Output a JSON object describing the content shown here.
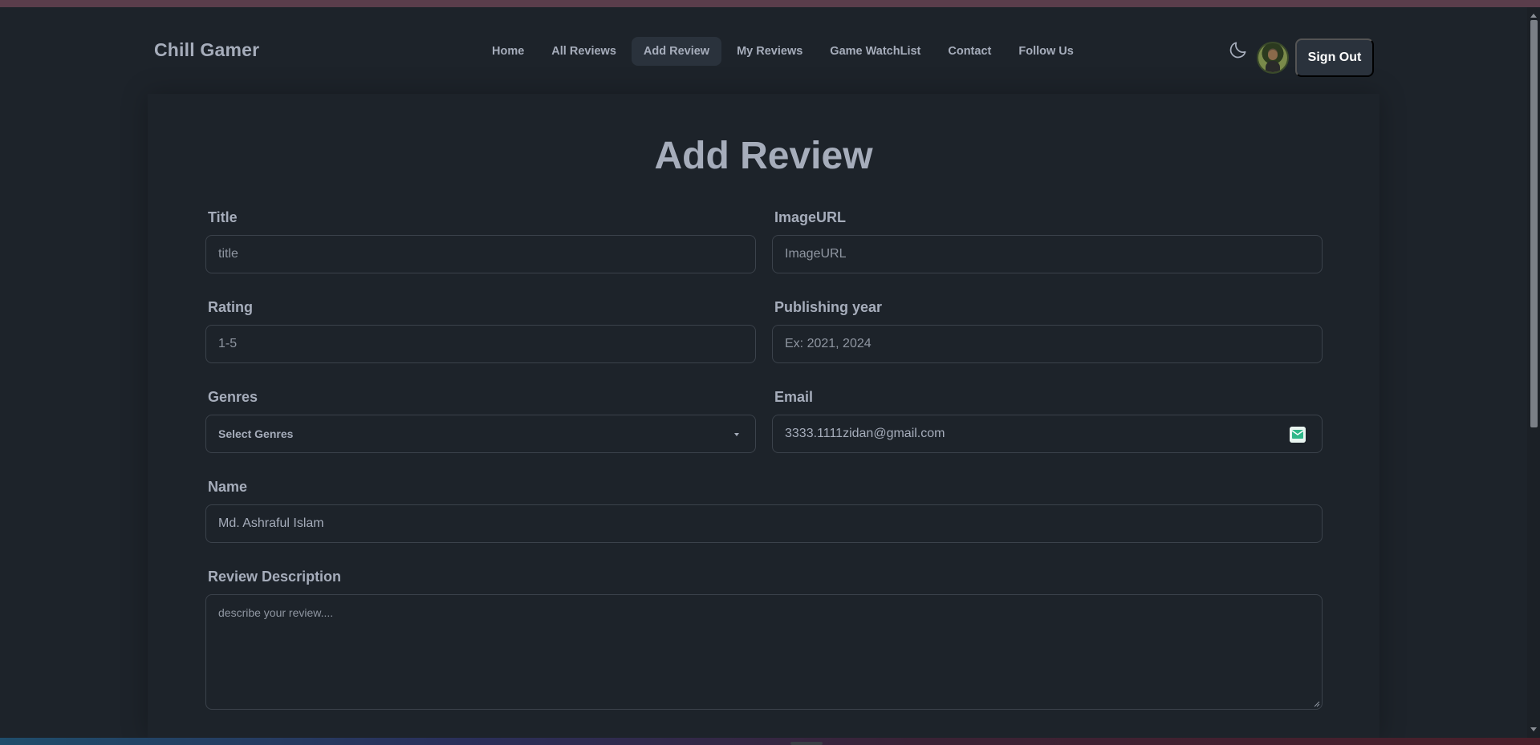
{
  "navbar": {
    "logo": "Chill Gamer",
    "menu": [
      {
        "label": "Home",
        "active": false
      },
      {
        "label": "All Reviews",
        "active": false
      },
      {
        "label": "Add Review",
        "active": true
      },
      {
        "label": "My Reviews",
        "active": false
      },
      {
        "label": "Game WatchList",
        "active": false
      },
      {
        "label": "Contact",
        "active": false
      },
      {
        "label": "Follow Us",
        "active": false
      }
    ],
    "theme_icon": "moon-icon",
    "signout_label": "Sign Out"
  },
  "page": {
    "title": "Add Review"
  },
  "form": {
    "title": {
      "label": "Title",
      "placeholder": "title",
      "value": ""
    },
    "image_url": {
      "label": "ImageURL",
      "placeholder": "ImageURL",
      "value": ""
    },
    "rating": {
      "label": "Rating",
      "placeholder": "1-5",
      "value": ""
    },
    "publishing_year": {
      "label": "Publishing year",
      "placeholder": "Ex: 2021, 2024",
      "value": ""
    },
    "genres": {
      "label": "Genres",
      "selected": "Select Genres"
    },
    "email": {
      "label": "Email",
      "value": "3333.1111zidan@gmail.com"
    },
    "name": {
      "label": "Name",
      "value": "Md. Ashraful Islam"
    },
    "description": {
      "label": "Review Description",
      "placeholder": "describe your review....",
      "value": ""
    }
  },
  "colors": {
    "background": "#1d232a",
    "text": "#a6adbb",
    "border": "#3b424b",
    "button_bg": "#2a323c"
  }
}
